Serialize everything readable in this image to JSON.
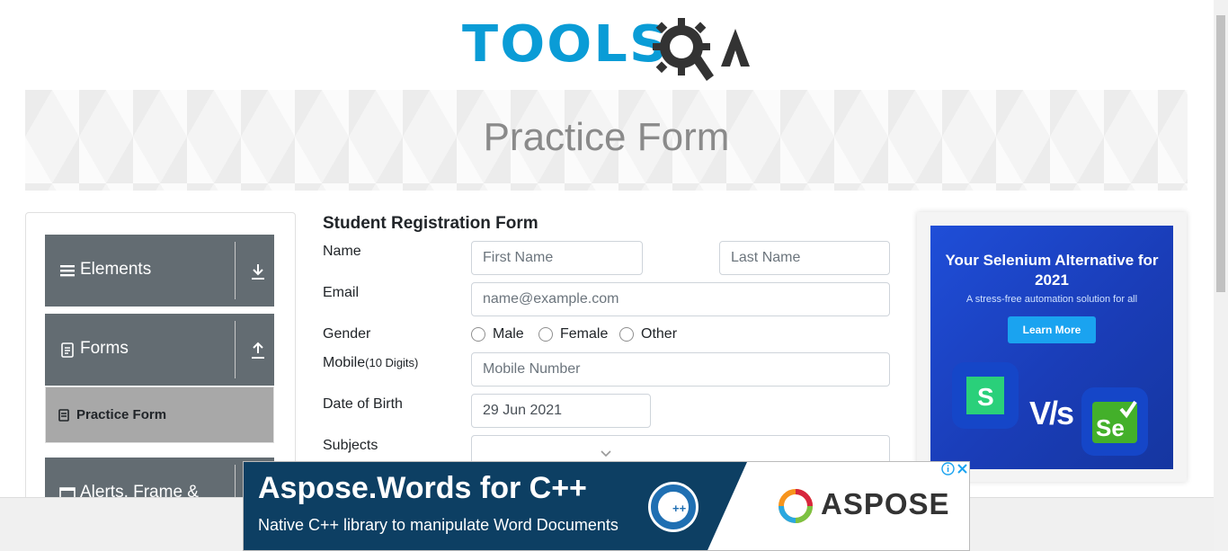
{
  "header": {
    "logo_text": "TOOLSQA"
  },
  "banner": {
    "title": "Practice Form"
  },
  "sidebar": {
    "groups": [
      {
        "label": "Elements",
        "icon": "hamburger-icon",
        "toggle_icon": "download-arrow-icon"
      },
      {
        "label": "Forms",
        "icon": "document-icon",
        "toggle_icon": "upload-arrow-icon"
      },
      {
        "label": "Alerts, Frame &",
        "icon": "window-icon"
      }
    ],
    "active_item": {
      "label": "Practice Form",
      "icon": "list-icon"
    }
  },
  "form": {
    "title": "Student Registration Form",
    "name_label": "Name",
    "first_name_placeholder": "First Name",
    "last_name_placeholder": "Last Name",
    "email_label": "Email",
    "email_placeholder": "name@example.com",
    "gender_label": "Gender",
    "gender_options": [
      "Male",
      "Female",
      "Other"
    ],
    "mobile_label": "Mobile",
    "mobile_hint": "(10 Digits)",
    "mobile_placeholder": "Mobile Number",
    "dob_label": "Date of Birth",
    "dob_value": "29 Jun 2021",
    "subjects_label": "Subjects"
  },
  "side_ad": {
    "headline": "Your Selenium Alternative for 2021",
    "subline": "A stress-free automation solution for all",
    "button": "Learn More",
    "vs": "V/s"
  },
  "bottom_ad": {
    "title": "Aspose.Words for C++",
    "subtitle": "Native C++ library to manipulate Word Documents",
    "brand": "ASPOSE"
  }
}
